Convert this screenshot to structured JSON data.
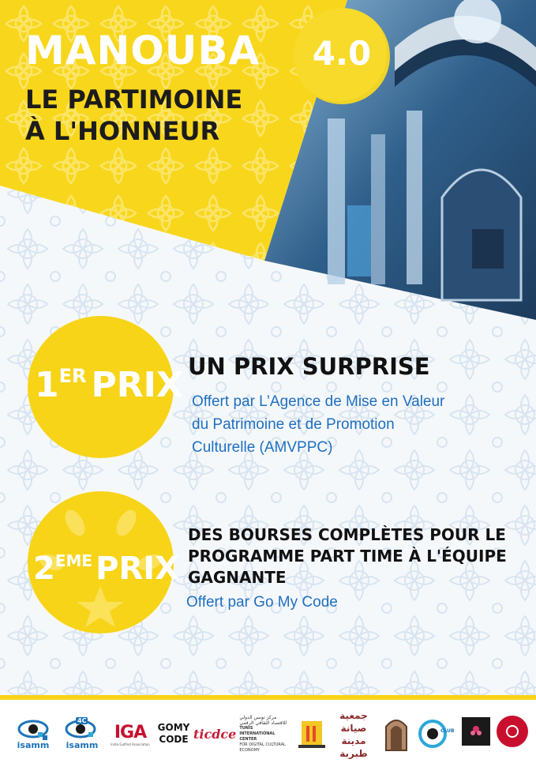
{
  "event": {
    "title": "MANOUBA",
    "version": "4.0",
    "subtitle_line1": "LE PARTIMOINE",
    "subtitle_line2": "À L'HONNEUR"
  },
  "prizes": [
    {
      "rank_number": "1",
      "rank_suffix": "ER",
      "rank_word": "PRIX",
      "title": "UN PRIX SURPRISE",
      "description_lines": [
        "Offert par L’Agence de Mise en Valeur",
        "du Patrimoine et de Promotion",
        "Culturelle (AMVPPC)"
      ]
    },
    {
      "rank_number": "2",
      "rank_suffix": "EME",
      "rank_word": "PRIX",
      "title_lines": [
        "DES BOURSES COMPLÈTES POUR LE",
        "PROGRAMME PART TIME À L'ÉQUIPE",
        "GAGNANTE"
      ],
      "description": "Offert par Go My Code"
    }
  ],
  "sponsors": {
    "isamm": "isamm",
    "isamm_4c": "isamm",
    "isamm_4c_badge": "4C",
    "iga": "IGA",
    "iga_caption": "India Gulfind Association",
    "gomycode_line1": "GOMY",
    "gomycode_line2": "CODE",
    "ticdce_logo": "ticdce",
    "ticdce_arabic": "مركز تونس الدولي للاقتصاد الثقافي الرقمي",
    "ticdce_en_line1": "TUNIS INTERNATIONAL CENTER",
    "ticdce_en_line2": "FOR DIGITAL CULTURAL ECONOMY",
    "assoc_arabic_line1": "جمعية صيانة",
    "assoc_arabic_line2": "مدينة طبربة",
    "club_text": "CLUB"
  },
  "colors": {
    "yellow": "#f7d418",
    "blue_text": "#1f6fc0",
    "dark_text": "#1c1c1c"
  }
}
